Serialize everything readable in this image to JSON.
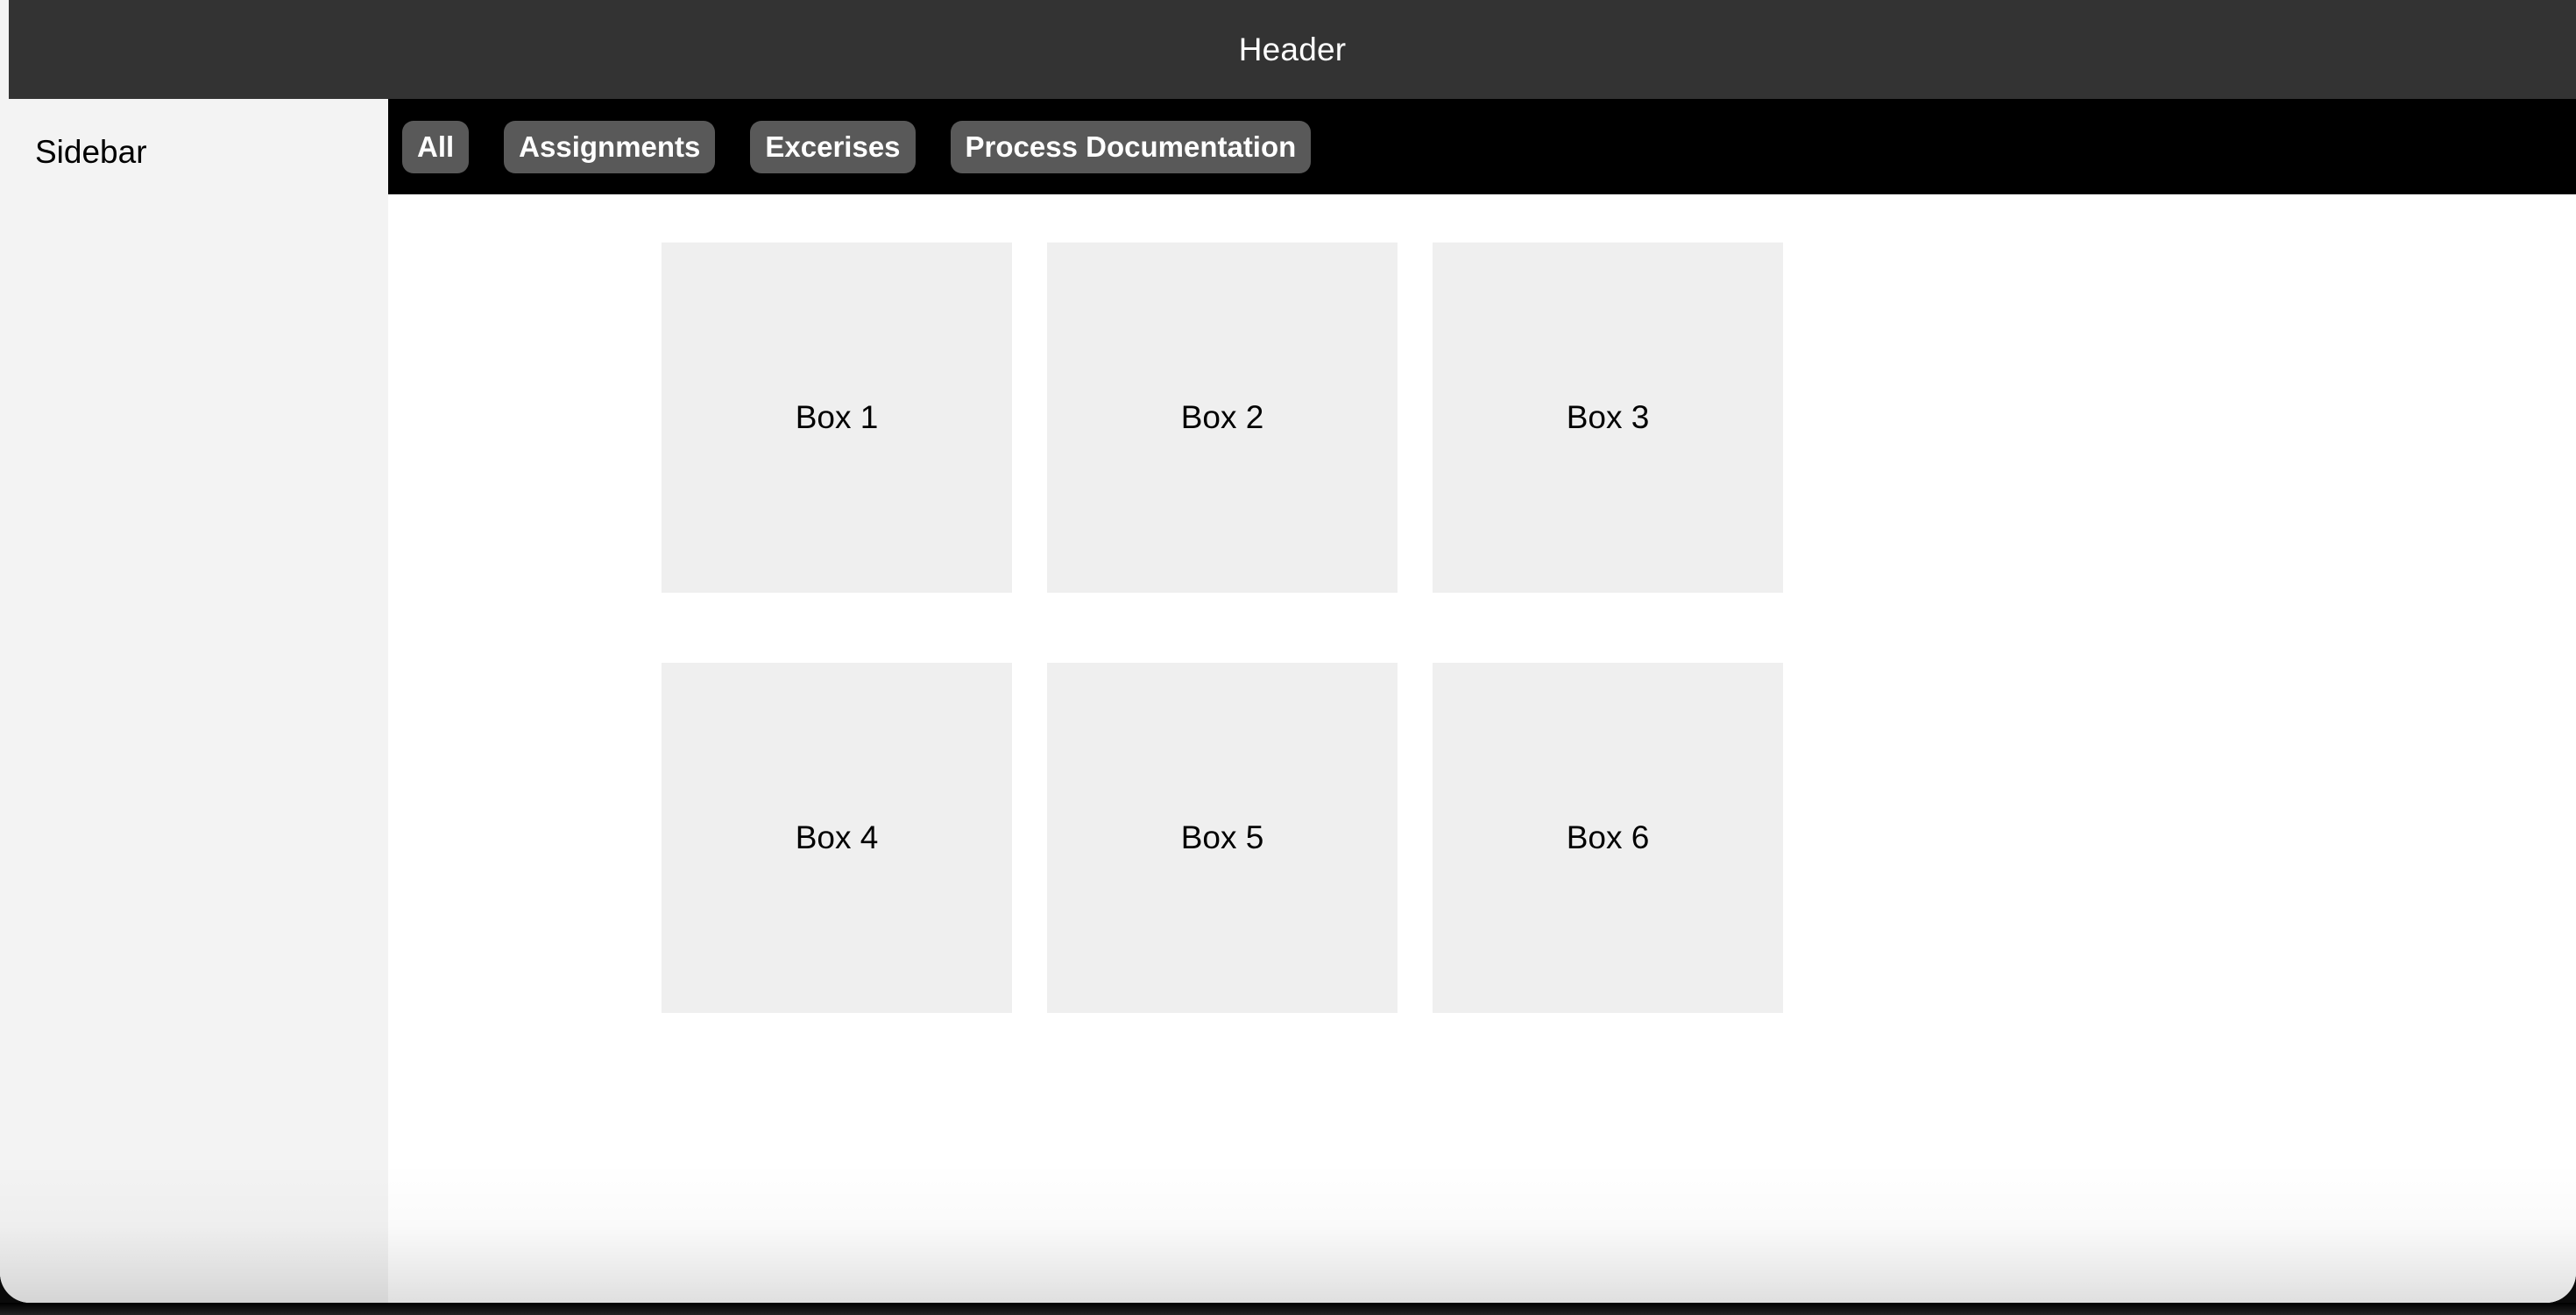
{
  "header": {
    "title": "Header",
    "background": "#333333",
    "text_color": "#ffffff"
  },
  "sidebar": {
    "title": "Sidebar",
    "background": "#f3f3f3"
  },
  "tabbar": {
    "background": "#000000",
    "pill_color": "#595959",
    "pill_text_color": "#ffffff",
    "tabs": [
      {
        "label": "All"
      },
      {
        "label": "Assignments"
      },
      {
        "label": "Excerises"
      },
      {
        "label": "Process Documentation"
      }
    ]
  },
  "main": {
    "background": "#ffffff",
    "box_color": "#efefef",
    "rows": [
      {
        "boxes": [
          {
            "label": "Box 1"
          },
          {
            "label": "Box 2"
          },
          {
            "label": "Box 3"
          }
        ]
      },
      {
        "boxes": [
          {
            "label": "Box 4"
          },
          {
            "label": "Box 5"
          },
          {
            "label": "Box 6"
          }
        ]
      }
    ]
  }
}
